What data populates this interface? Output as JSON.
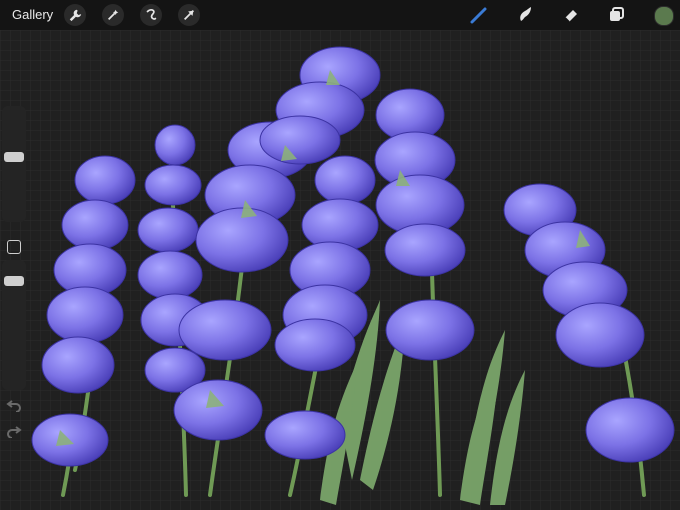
{
  "app": {
    "gallery_label": "Gallery"
  },
  "toolbar": {
    "left_tools": [
      "actions",
      "adjustments",
      "selection",
      "transform"
    ],
    "right_tools": [
      "brush",
      "smudge",
      "eraser",
      "layers"
    ]
  },
  "colors": {
    "active_color": "#5b7a4e",
    "brush_active": "#3a7bd5",
    "background": "#1f1f1f",
    "lavender": "#7c72e6",
    "stem": "#6f9a55",
    "leaf": "#7aa56a"
  }
}
